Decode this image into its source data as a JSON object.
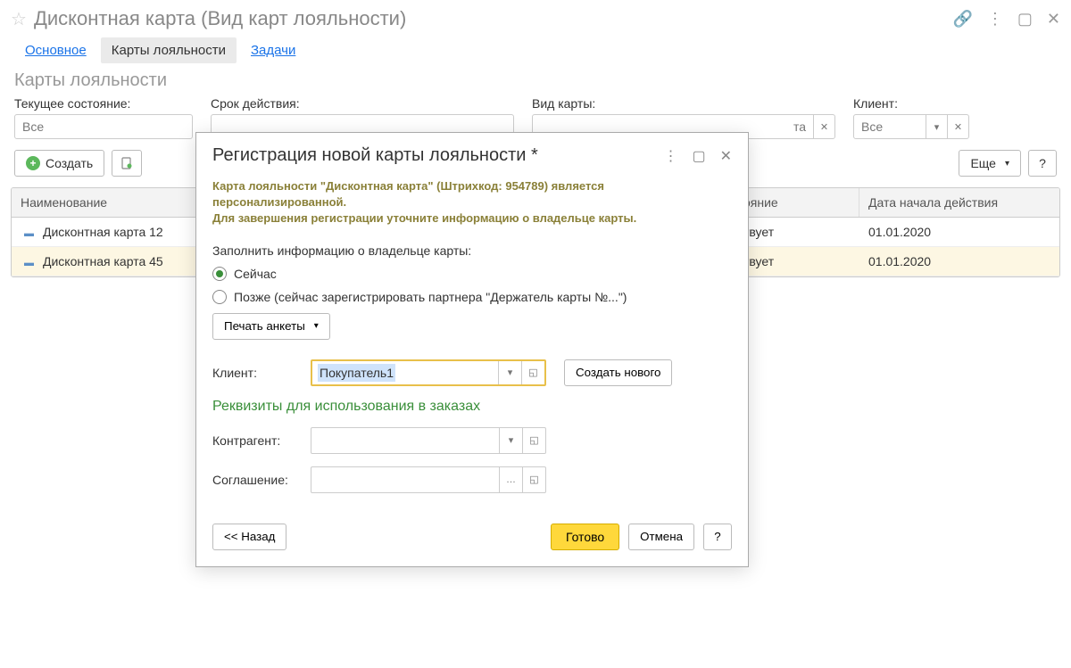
{
  "titlebar": {
    "title": "Дисконтная карта (Вид карт лояльности)"
  },
  "tabs": [
    {
      "label": "Основное"
    },
    {
      "label": "Карты лояльности"
    },
    {
      "label": "Задачи"
    }
  ],
  "section_title": "Карты лояльности",
  "filters": {
    "state": {
      "label": "Текущее состояние:",
      "value": "Все"
    },
    "validity": {
      "label": "Срок действия:",
      "value": ""
    },
    "card_type": {
      "label": "Вид карты:",
      "value": "Дисконтная карта"
    },
    "client": {
      "label": "Клиент:",
      "value": "Все"
    }
  },
  "toolbar": {
    "create": "Создать",
    "more": "Еще",
    "help": "?"
  },
  "table": {
    "columns": {
      "name": "Наименование",
      "state": "ояние",
      "start": "Дата начала действия"
    },
    "rows": [
      {
        "name": "Дисконтная карта 12",
        "state": "твует",
        "start": "01.01.2020"
      },
      {
        "name": "Дисконтная карта 45",
        "state": "твует",
        "start": "01.01.2020"
      }
    ]
  },
  "modal": {
    "title": "Регистрация новой карты лояльности *",
    "hint1": "Карта лояльности \"Дисконтная карта\" (Штрихкод: 954789) является персонализированной.",
    "hint2": "Для завершения регистрации уточните информацию о владельце карты.",
    "fill_label": "Заполнить информацию о владельце карты:",
    "radio_now": "Сейчас",
    "radio_later": "Позже (сейчас зарегистрировать партнера \"Держатель карты №...\")",
    "print_form": "Печать анкеты",
    "client_label": "Клиент:",
    "client_value": "Покупатель1",
    "create_new": "Создать нового",
    "section_green": "Реквизиты для использования в заказах",
    "contractor_label": "Контрагент:",
    "contractor_value": "",
    "agreement_label": "Соглашение:",
    "agreement_value": "",
    "back": "<< Назад",
    "done": "Готово",
    "cancel": "Отмена",
    "help": "?"
  }
}
